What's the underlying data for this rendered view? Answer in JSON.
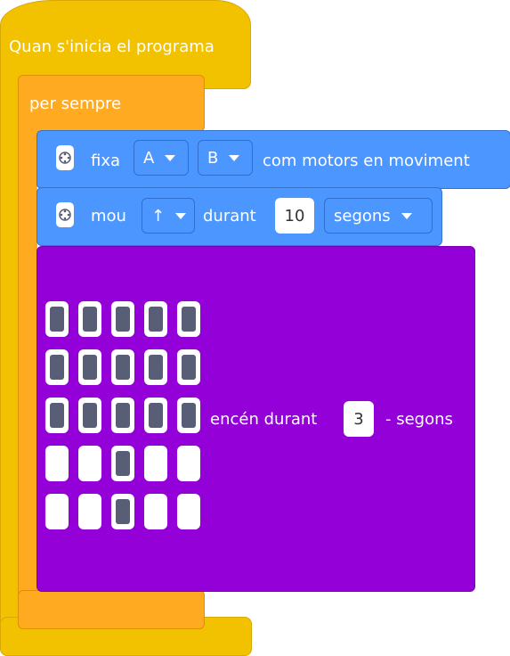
{
  "hat": {
    "label": "Quan s'inicia el programa"
  },
  "forever": {
    "label": "per sempre"
  },
  "motors_block": {
    "icon": "robot-icon",
    "label": "fixa",
    "motor_a": "A",
    "motor_b": "B",
    "suffix": "com motors en moviment"
  },
  "move_block": {
    "icon": "robot-icon",
    "label": "mou",
    "direction": "↑",
    "middle": "durant",
    "duration": "10",
    "unit": "segons"
  },
  "display_block": {
    "label": "encén durant",
    "duration": "3",
    "unit": "- segons",
    "leds": [
      [
        1,
        1,
        1,
        1,
        1
      ],
      [
        1,
        1,
        1,
        1,
        1
      ],
      [
        1,
        1,
        1,
        1,
        1
      ],
      [
        0,
        0,
        1,
        0,
        0
      ],
      [
        0,
        0,
        1,
        0,
        0
      ]
    ]
  },
  "colors": {
    "events": "#f2c200",
    "control": "#ffaa20",
    "motion": "#4c97ff",
    "looks": "#9300d8",
    "led_on": "#575e75"
  }
}
